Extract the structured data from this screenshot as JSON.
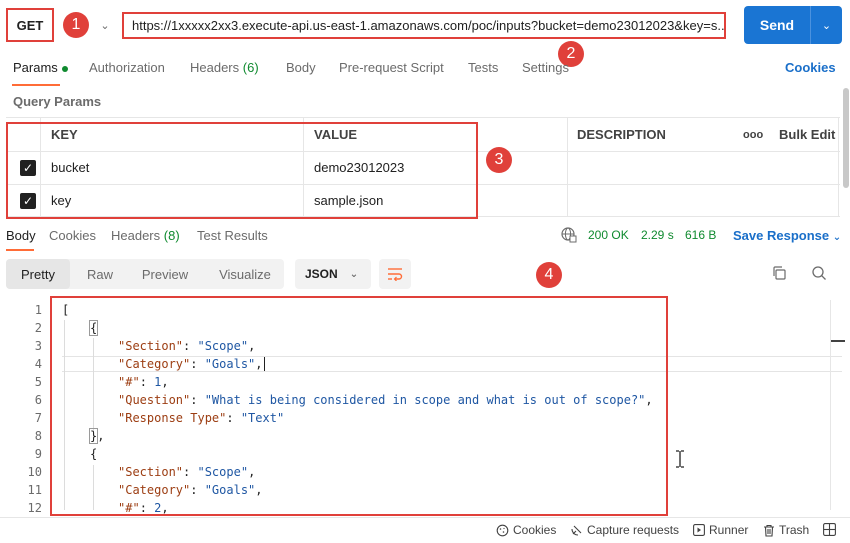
{
  "request": {
    "method": "GET",
    "url": "https://1xxxxx2xx3.execute-api.us-east-1.amazonaws.com/poc/inputs?bucket=demo23012023&key=s...",
    "send_label": "Send"
  },
  "annotations": [
    "1",
    "2",
    "3",
    "4"
  ],
  "request_tabs": {
    "params": "Params",
    "authorization": "Authorization",
    "headers": "Headers",
    "headers_count": "(6)",
    "body": "Body",
    "prerequest": "Pre-request Script",
    "tests": "Tests",
    "settings": "Settings",
    "cookies": "Cookies"
  },
  "query_params": {
    "label": "Query Params",
    "headers": {
      "key": "KEY",
      "value": "VALUE",
      "description": "DESCRIPTION",
      "bulk_edit": "Bulk Edit",
      "more": "ooo"
    },
    "rows": [
      {
        "key": "bucket",
        "value": "demo23012023",
        "checked": true
      },
      {
        "key": "key",
        "value": "sample.json",
        "checked": true
      }
    ]
  },
  "response_tabs": {
    "body": "Body",
    "cookies": "Cookies",
    "headers": "Headers",
    "headers_count": "(8)",
    "test_results": "Test Results",
    "status": "200 OK",
    "time": "2.29 s",
    "size": "616 B",
    "save_response": "Save Response"
  },
  "format_bar": {
    "pretty": "Pretty",
    "raw": "Raw",
    "preview": "Preview",
    "visualize": "Visualize",
    "format": "JSON"
  },
  "code": {
    "line_numbers": [
      "1",
      "2",
      "3",
      "4",
      "5",
      "6",
      "7",
      "8",
      "9",
      "10",
      "11",
      "12"
    ],
    "lines": {
      "l1": "[",
      "l2": "{",
      "l3_key": "\"Section\"",
      "l3_val": "\"Scope\"",
      "l4_key": "\"Category\"",
      "l4_val": "\"Goals\"",
      "l5_key": "\"#\"",
      "l5_val": "1",
      "l6_key": "\"Question\"",
      "l6_val": "\"What is being considered in scope and what is out of scope?\"",
      "l7_key": "\"Response Type\"",
      "l7_val": "\"Text\"",
      "l8": "}",
      "l9": "{",
      "l10_key": "\"Section\"",
      "l10_val": "\"Scope\"",
      "l11_key": "\"Category\"",
      "l11_val": "\"Goals\"",
      "l12_key": "\"#\"",
      "l12_val": "2"
    }
  },
  "footer": {
    "cookies": "Cookies",
    "capture": "Capture requests",
    "runner": "Runner",
    "trash": "Trash"
  },
  "colors": {
    "accent": "#ff6c37",
    "send": "#1a75d3",
    "annotation": "#e0403a",
    "status_ok": "#0f8a2f"
  }
}
